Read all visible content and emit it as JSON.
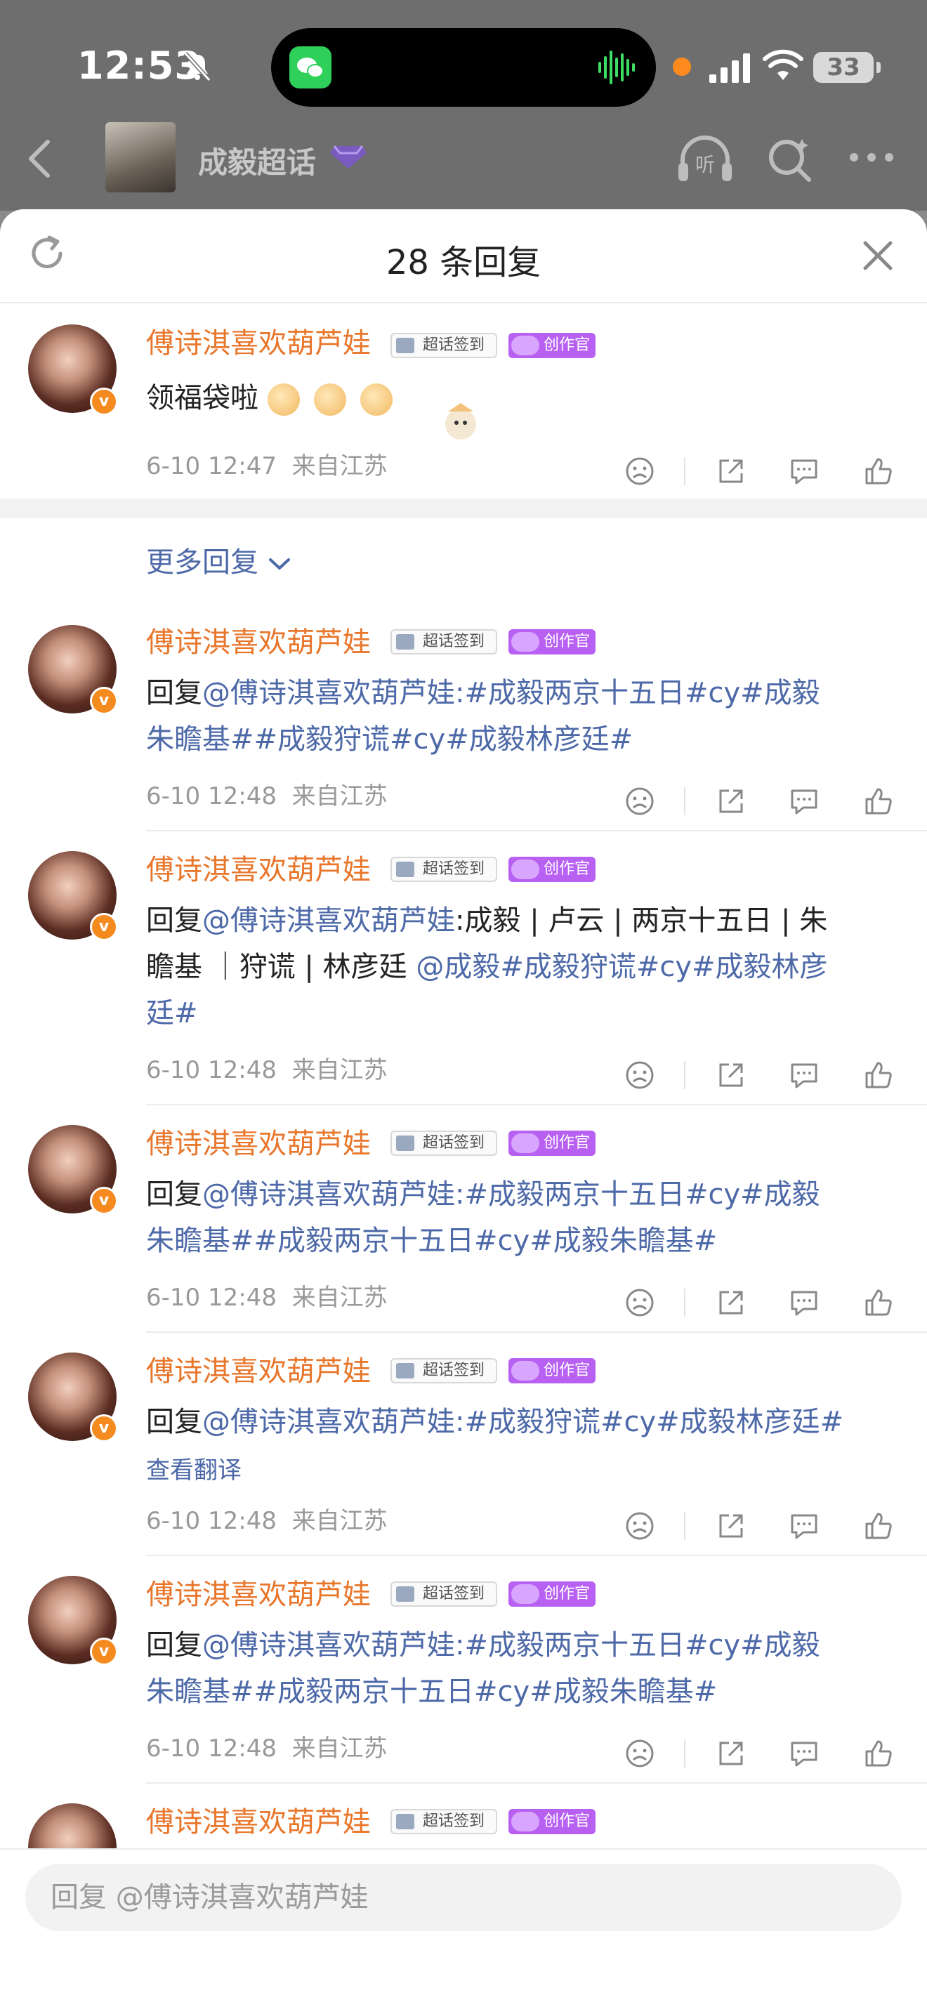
{
  "status_bar": {
    "time": "12:53",
    "battery": "33"
  },
  "nav": {
    "title": "成毅超话"
  },
  "sheet": {
    "title": "28 条回复"
  },
  "root_comment": {
    "username": "傅诗淇喜欢葫芦娃",
    "tag_sign": "超话签到",
    "tag_creator": "创作官",
    "text": "领福袋啦",
    "time": "6-10 12:47",
    "location": "来自江苏"
  },
  "more_replies": "更多回复",
  "replies": [
    {
      "username": "傅诗淇喜欢葫芦娃",
      "prefix": "回复",
      "mention": "@傅诗淇喜欢葫芦娃",
      "line1_rest": ":#成毅两京十五日#cy#成毅",
      "line2": "朱瞻基##成毅狩谎#cy#成毅林彦廷#",
      "time": "6-10 12:48",
      "location": "来自江苏"
    },
    {
      "username": "傅诗淇喜欢葫芦娃",
      "prefix": "回复",
      "mention": "@傅诗淇喜欢葫芦娃",
      "line1_rest": ":成毅 | 卢云 | 两京十五日 | 朱",
      "line2_plain": "瞻基 ｜狩谎 | 林彦廷 ",
      "line2_link": "@成毅#成毅狩谎#cy#成毅林彦",
      "line3": "廷#",
      "time": "6-10 12:48",
      "location": "来自江苏"
    },
    {
      "username": "傅诗淇喜欢葫芦娃",
      "prefix": "回复",
      "mention": "@傅诗淇喜欢葫芦娃",
      "line1_rest": ":#成毅两京十五日#cy#成毅",
      "line2": "朱瞻基##成毅两京十五日#cy#成毅朱瞻基#",
      "time": "6-10 12:48",
      "location": "来自江苏"
    },
    {
      "username": "傅诗淇喜欢葫芦娃",
      "prefix": "回复",
      "mention": "@傅诗淇喜欢葫芦娃",
      "line1_rest": ":#成毅狩谎#cy#成毅林彦廷#",
      "translate": "查看翻译",
      "time": "6-10 12:48",
      "location": "来自江苏"
    },
    {
      "username": "傅诗淇喜欢葫芦娃",
      "prefix": "回复",
      "mention": "@傅诗淇喜欢葫芦娃",
      "line1_rest": ":#成毅两京十五日#cy#成毅",
      "line2": "朱瞻基##成毅两京十五日#cy#成毅朱瞻基#",
      "time": "6-10 12:48",
      "location": "来自江苏"
    },
    {
      "username": "傅诗淇喜欢葫芦娃"
    }
  ],
  "tags": {
    "sign": "超话签到",
    "creator": "创作官"
  },
  "reply_input": {
    "placeholder": "回复 @傅诗淇喜欢葫芦娃"
  },
  "colors": {
    "username": "#e8762b",
    "link": "#4d69a8",
    "creator_tag": "#b760f2",
    "badge": "#f58a1f"
  }
}
